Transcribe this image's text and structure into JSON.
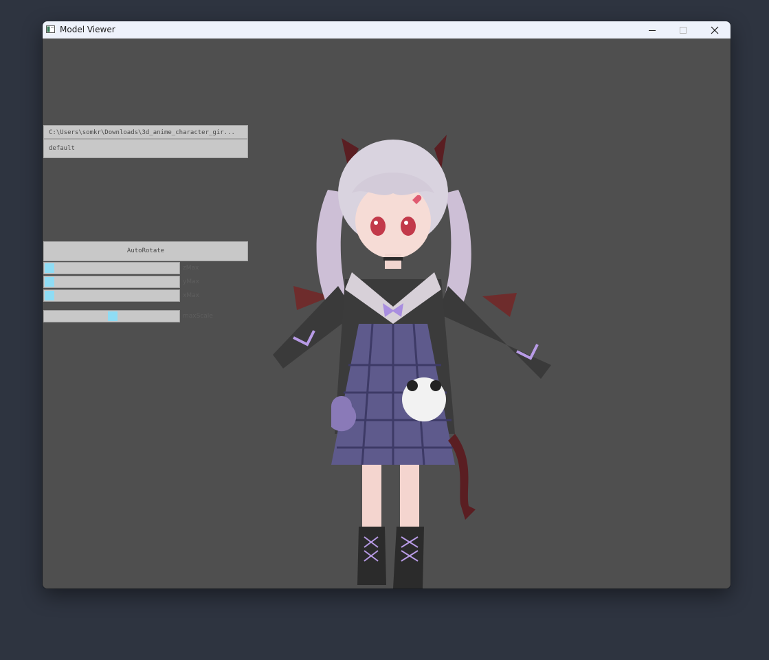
{
  "window": {
    "title": "Model Viewer",
    "icon": "app-window-icon"
  },
  "titlebar_buttons": {
    "minimize": "minimize-icon",
    "maximize": "maximize-icon",
    "close": "close-icon"
  },
  "panel": {
    "model_path": "C:\\Users\\somkr\\Downloads\\3d_anime_character_gir...",
    "animation": "default",
    "autorotate_label": "AutoRotate",
    "sliders": [
      {
        "label": "zMax",
        "value": 0.05
      },
      {
        "label": "yMax",
        "value": 0.05
      },
      {
        "label": "xMax",
        "value": 0.05
      },
      {
        "label": "maxScale",
        "value": 0.5
      }
    ]
  },
  "colors": {
    "viewport_bg": "#4f4f4f",
    "slider_fill": "#8fdcf4",
    "control_bg": "#c8c8c8",
    "desktop_bg": "#2e3440"
  }
}
